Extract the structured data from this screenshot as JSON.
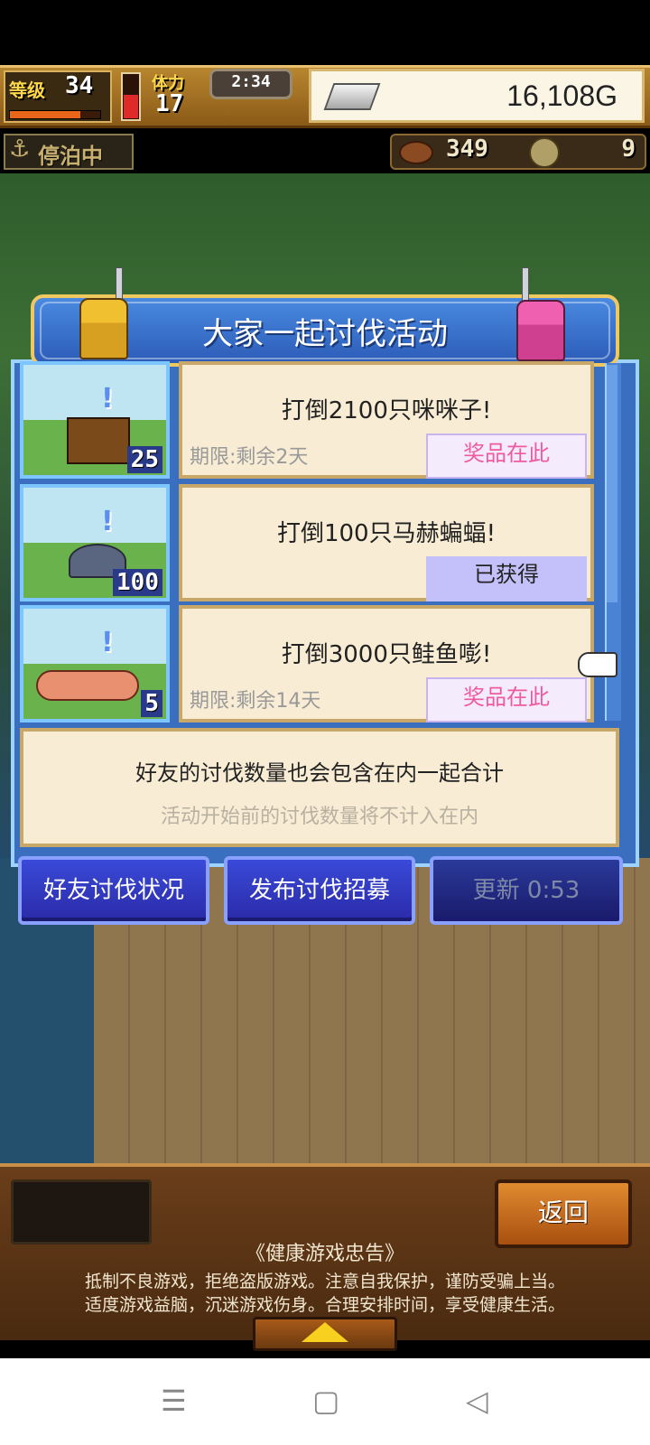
{
  "hud": {
    "level_label": "等级",
    "level": "34",
    "level_exp_fraction": 0.78,
    "stamina_label": "体力",
    "stamina": "17",
    "stamina_fill_fraction": 0.55,
    "timer": "2:34",
    "gold": "16,108G"
  },
  "status": {
    "anchor_icon": "⚓",
    "docked_text": "停泊中",
    "food": "349",
    "medals": "9"
  },
  "panel": {
    "title": "大家一起讨伐活动",
    "quests": [
      {
        "title": "打倒2100只咪咪子!",
        "deadline": "期限:剩余2天",
        "count": "25",
        "prize": "奖品在此",
        "prize_state": "pending"
      },
      {
        "title": "打倒100只马赫蝙蝠!",
        "deadline": "",
        "count": "100",
        "prize": "已获得",
        "prize_state": "done"
      },
      {
        "title": "打倒3000只鲑鱼嘭!",
        "deadline": "期限:剩余14天",
        "count": "5",
        "prize": "奖品在此",
        "prize_state": "pending"
      }
    ],
    "scroll_fraction": 0.67,
    "note_main": "好友的讨伐数量也会包含在内一起合计",
    "note_sub": "活动开始前的讨伐数量将不计入在内"
  },
  "buttons": {
    "friend_status": "好友讨伐状况",
    "recruit": "发布讨伐招募",
    "refresh": "更新 0:53",
    "back": "返回"
  },
  "health_notice": {
    "title": "《健康游戏忠告》",
    "line1": "抵制不良游戏，拒绝盗版游戏。注意自我保护，谨防受骗上当。",
    "line2": "适度游戏益脑，沉迷游戏伤身。合理安排时间，享受健康生活。"
  },
  "nav": {
    "menu_icon": "☰",
    "home_icon": "▢",
    "back_icon": "◁"
  }
}
